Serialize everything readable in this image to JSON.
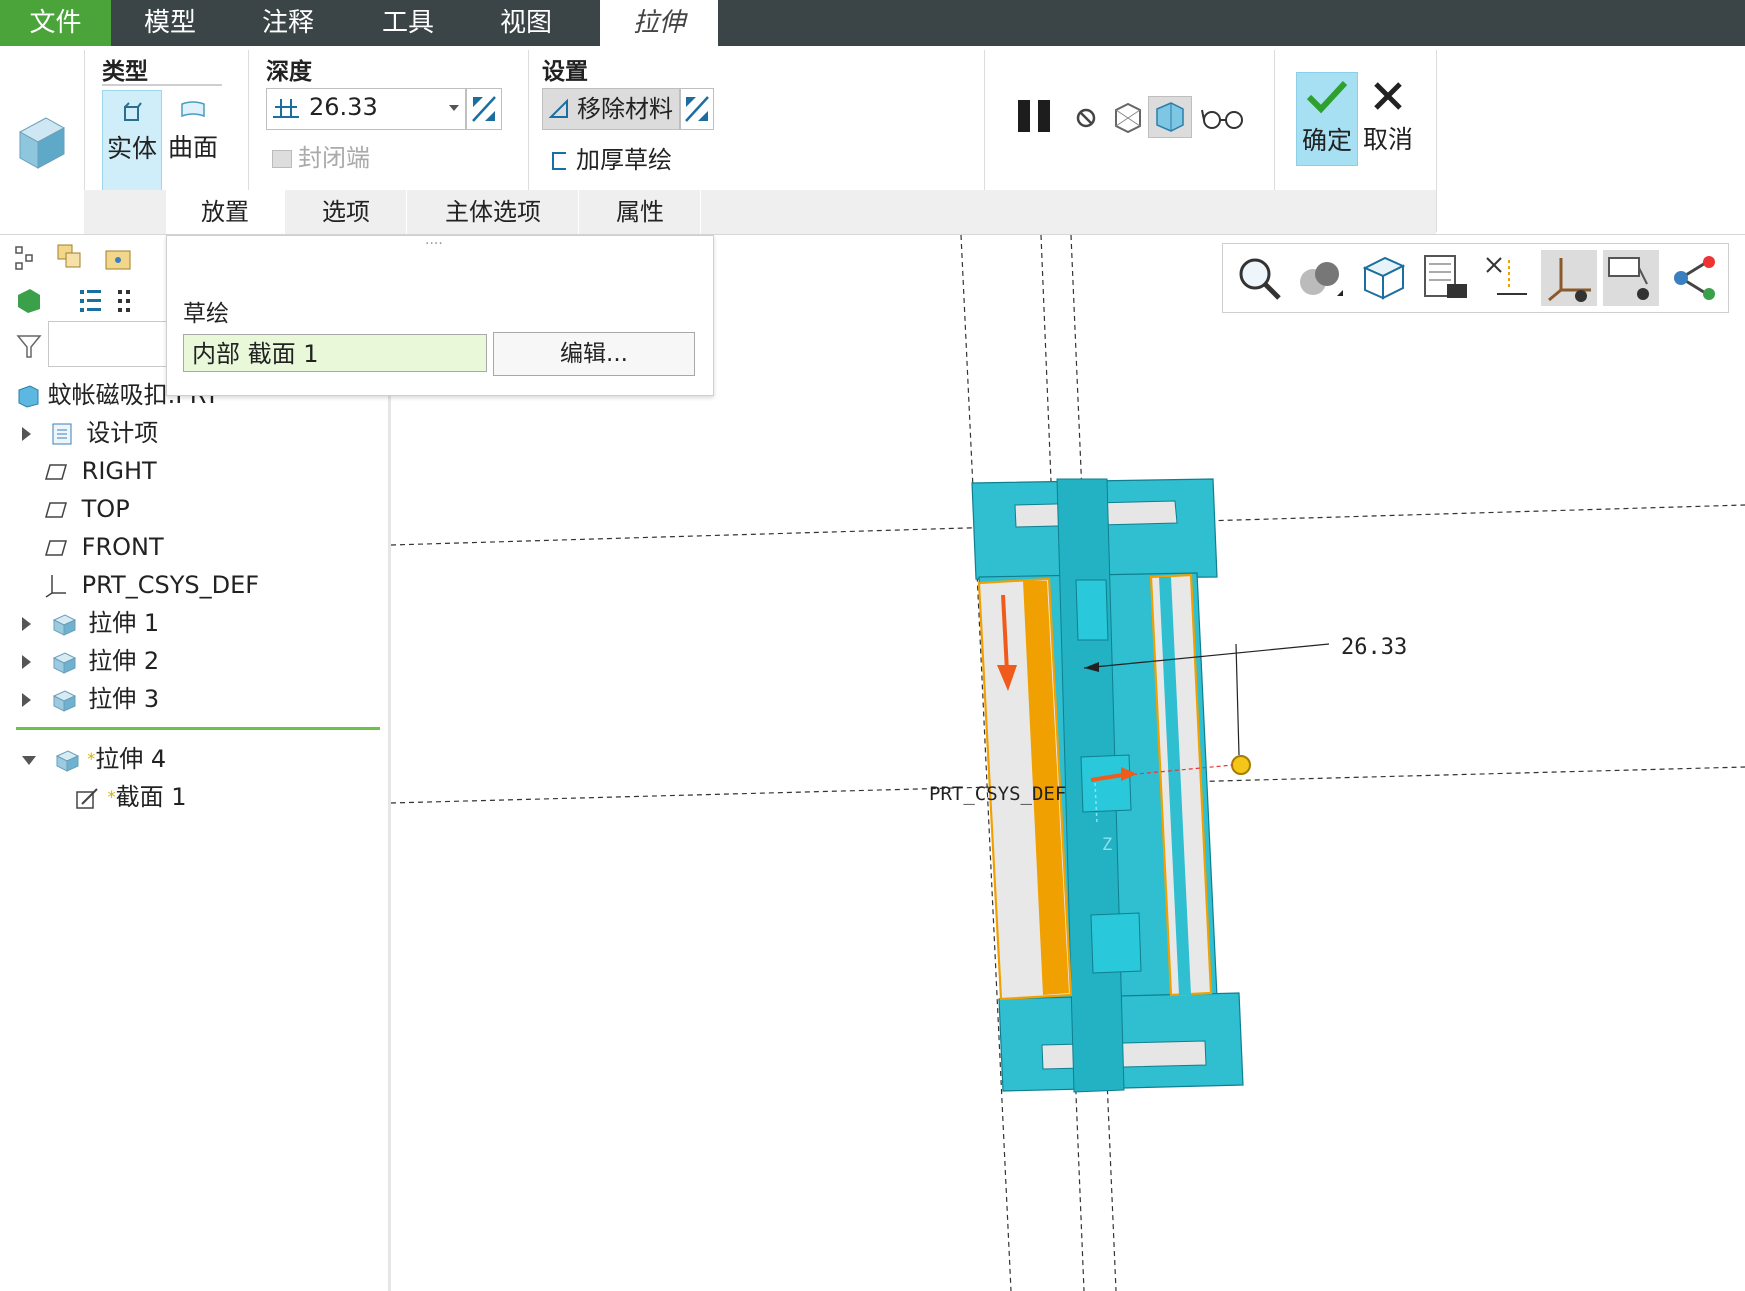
{
  "menu": {
    "file": "文件",
    "model": "模型",
    "annotate": "注释",
    "tools": "工具",
    "view": "视图",
    "extrude": "拉伸"
  },
  "ribbon": {
    "type_group": "类型",
    "solid": "实体",
    "surface": "曲面",
    "depth_group": "深度",
    "depth_value": "26.33",
    "capped_ends": "封闭端",
    "settings_group": "设置",
    "remove_material": "移除材料",
    "thicken_sketch": "加厚草绘",
    "ok": "确定",
    "cancel": "取消"
  },
  "subtabs": [
    "放置",
    "选项",
    "主体选项",
    "属性"
  ],
  "popup": {
    "grip": "····",
    "sketch_label": "草绘",
    "sketch_value": "内部 截面 1",
    "edit_button": "编辑..."
  },
  "tree": {
    "root": "蚊帐磁吸扣.PRT",
    "items": [
      {
        "label": "设计项",
        "icon": "design-items-icon"
      },
      {
        "label": "RIGHT",
        "icon": "datum-plane-icon"
      },
      {
        "label": "TOP",
        "icon": "datum-plane-icon"
      },
      {
        "label": "FRONT",
        "icon": "datum-plane-icon"
      },
      {
        "label": "PRT_CSYS_DEF",
        "icon": "csys-icon"
      },
      {
        "label": "拉伸 1",
        "icon": "extrude-icon"
      },
      {
        "label": "拉伸 2",
        "icon": "extrude-icon"
      },
      {
        "label": "拉伸 3",
        "icon": "extrude-icon"
      },
      {
        "label": "拉伸 4",
        "icon": "extrude-icon"
      },
      {
        "label": "截面 1",
        "icon": "sketch-icon"
      }
    ],
    "new_marker": "*"
  },
  "graphics": {
    "dimension": "26.33",
    "csys_label": "PRT_CSYS_DEF",
    "axis_z": "Z"
  },
  "colors": {
    "menubar": "#3b4446",
    "file_green": "#4aa43a",
    "model_cyan": "#2fbfd0",
    "highlight_orange": "#f0a000",
    "selected_blue": "#cfeef9"
  }
}
